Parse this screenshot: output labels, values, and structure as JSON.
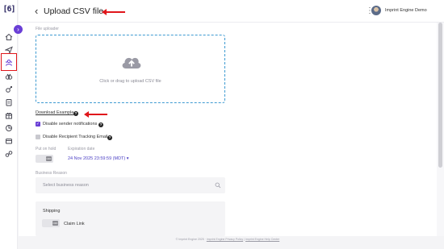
{
  "brand": {
    "logo_text": "[6]"
  },
  "nav": {
    "items": [
      "home-icon",
      "send-icon",
      "recipients-icon",
      "campaigns-icon",
      "integrations-icon",
      "catalog-icon",
      "gifts-icon",
      "analytics-icon",
      "orders-icon",
      "automation-icon"
    ],
    "active": "recipients-icon"
  },
  "header": {
    "title": "Upload CSV file",
    "user_name": "Imprint Engine Demo"
  },
  "uploader": {
    "section_label": "File uploader",
    "drop_text": "Click or drag to upload CSV file"
  },
  "download_example": {
    "label": "Download Example"
  },
  "options": {
    "disable_sender_notifications": {
      "label": "Disable sender notifications",
      "checked": true
    },
    "disable_recipient_tracking_email": {
      "label": "Disable Recipient Tracking Email",
      "checked": false
    }
  },
  "put_on_hold": {
    "label": "Put on hold",
    "toggle_text": "OFF"
  },
  "expiration": {
    "label": "Expiration date",
    "value": "24 Nov 2025 23:59:59 (MDT)"
  },
  "business_reason": {
    "label": "Business Reason",
    "placeholder": "Select business reason"
  },
  "shipping": {
    "title": "Shipping",
    "claim_link": {
      "label": "Claim Link",
      "toggle_text": "OFF"
    }
  },
  "footer": {
    "copyright": "© Imprint Engine 2025 · ",
    "privacy_link": "Imprint Engine Privacy Policy",
    "separator": " | ",
    "help_link": "Imprint Engine Help Center"
  },
  "colors": {
    "accent": "#6a3fd6",
    "link_blue": "#4b3fc4",
    "dropzone_border": "#3d9ad1",
    "annotation_red": "#e0161b"
  }
}
